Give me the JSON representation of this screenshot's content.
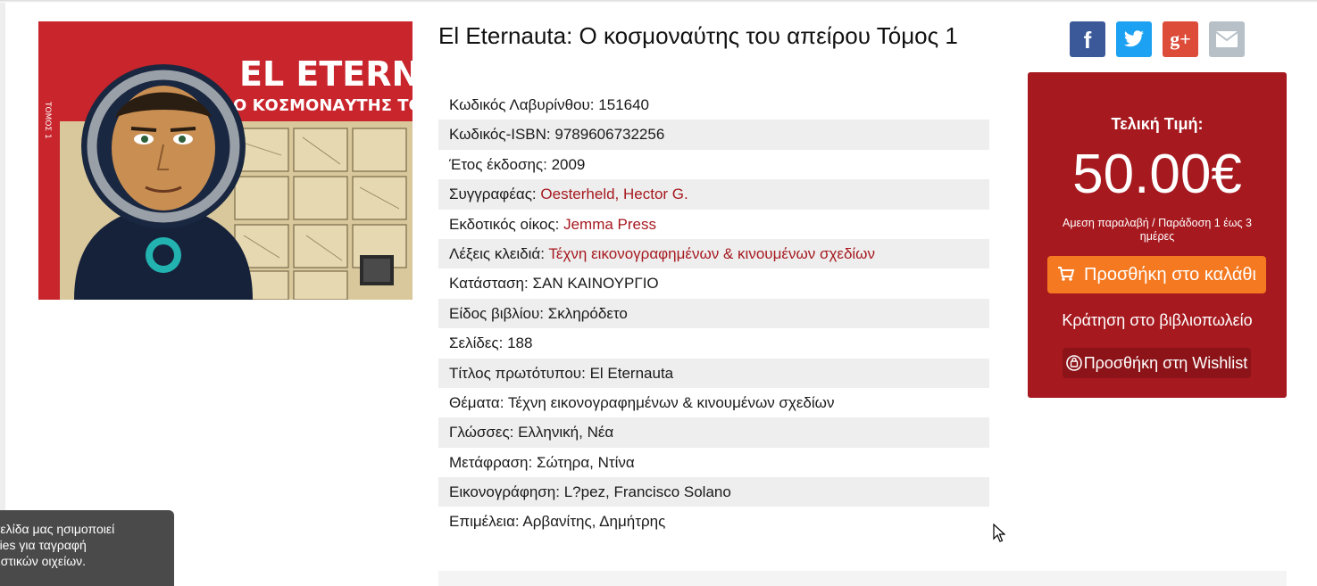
{
  "cover": {
    "series_label": "ΤΟΜΟΣ 1",
    "title_line1": "EL ETERNAUTA",
    "title_line2": "Ο ΚΟΣΜΟΝΑΥΤΗΣ ΤΟΥ ΑΠΕΙΡΟΥ"
  },
  "product": {
    "title": "El Eternauta: Ο κοσμοναύτης του απείρου Τόμος 1",
    "details": [
      {
        "label": "Κωδικός Λαβυρίνθου:",
        "value": "151640",
        "link": false
      },
      {
        "label": "Κωδικός-ISBN:",
        "value": "9789606732256",
        "link": false
      },
      {
        "label": "Έτος έκδοσης:",
        "value": "2009",
        "link": false
      },
      {
        "label": "Συγγραφέας:",
        "value": "Oesterheld, Hector G.",
        "link": true
      },
      {
        "label": "Εκδοτικός οίκος:",
        "value": "Jemma Press",
        "link": true
      },
      {
        "label": "Λέξεις κλειδιά:",
        "value": "Τέχνη εικονογραφημένων & κινουμένων σχεδίων",
        "link": true
      },
      {
        "label": "Κατάσταση:",
        "value": "ΣΑΝ ΚΑΙΝΟΥΡΓΙΟ",
        "link": false
      },
      {
        "label": "Είδος βιβλίου:",
        "value": "Σκληρόδετο",
        "link": false
      },
      {
        "label": "Σελίδες:",
        "value": "188",
        "link": false
      },
      {
        "label": "Τίτλος πρωτότυπου:",
        "value": "El Eternauta",
        "link": false
      },
      {
        "label": "Θέματα:",
        "value": "Τέχνη εικονογραφημένων & κινουμένων σχεδίων",
        "link": false
      },
      {
        "label": "Γλώσσες:",
        "value": "Ελληνική, Νέα",
        "link": false
      },
      {
        "label": "Μετάφραση:",
        "value": "Σώτηρα, Ντίνα",
        "link": false
      },
      {
        "label": "Εικονογράφηση:",
        "value": "L?pez, Francisco Solano",
        "link": false
      },
      {
        "label": "Επιμέλεια:",
        "value": "Αρβανίτης, Δημήτρης",
        "link": false
      }
    ]
  },
  "share": {
    "facebook_icon": "facebook-icon",
    "twitter_icon": "twitter-icon",
    "googleplus_icon": "google-plus-icon",
    "email_icon": "email-icon",
    "facebook_glyph": "f",
    "googleplus_glyph": "g+"
  },
  "purchase": {
    "price_label": "Τελική Τιμή:",
    "price": "50.00€",
    "delivery": "Αμεση παραλαβή / Παράδοση 1 έως 3 ημέρες",
    "add_to_cart": "Προσθήκη στο καλάθι",
    "reserve": "Κράτηση στο βιβλιοπωλείο",
    "wishlist": "Προσθήκη στη Wishlist"
  },
  "cookie_notice": {
    "text": "στοσελίδα μας ησιμοποιεί cookies για ταγραφή στατιστικών οιχείων."
  },
  "colors": {
    "brand_red": "#a6191f",
    "cart_orange": "#f47920",
    "facebook": "#3b5998",
    "twitter": "#1da1f2",
    "googleplus": "#dd4b39",
    "email": "#b7c0c6"
  }
}
